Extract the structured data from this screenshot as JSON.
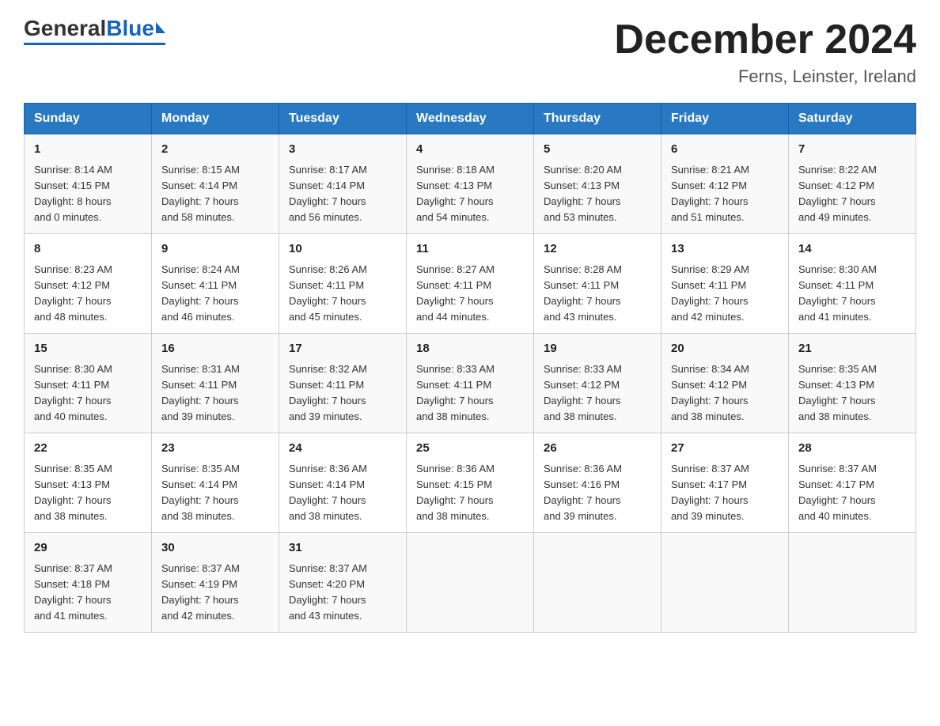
{
  "header": {
    "logo": {
      "general": "General",
      "blue": "Blue"
    },
    "title": "December 2024",
    "location": "Ferns, Leinster, Ireland"
  },
  "columns": [
    "Sunday",
    "Monday",
    "Tuesday",
    "Wednesday",
    "Thursday",
    "Friday",
    "Saturday"
  ],
  "weeks": [
    [
      {
        "day": "1",
        "sunrise": "Sunrise: 8:14 AM",
        "sunset": "Sunset: 4:15 PM",
        "daylight": "Daylight: 8 hours",
        "daylight2": "and 0 minutes."
      },
      {
        "day": "2",
        "sunrise": "Sunrise: 8:15 AM",
        "sunset": "Sunset: 4:14 PM",
        "daylight": "Daylight: 7 hours",
        "daylight2": "and 58 minutes."
      },
      {
        "day": "3",
        "sunrise": "Sunrise: 8:17 AM",
        "sunset": "Sunset: 4:14 PM",
        "daylight": "Daylight: 7 hours",
        "daylight2": "and 56 minutes."
      },
      {
        "day": "4",
        "sunrise": "Sunrise: 8:18 AM",
        "sunset": "Sunset: 4:13 PM",
        "daylight": "Daylight: 7 hours",
        "daylight2": "and 54 minutes."
      },
      {
        "day": "5",
        "sunrise": "Sunrise: 8:20 AM",
        "sunset": "Sunset: 4:13 PM",
        "daylight": "Daylight: 7 hours",
        "daylight2": "and 53 minutes."
      },
      {
        "day": "6",
        "sunrise": "Sunrise: 8:21 AM",
        "sunset": "Sunset: 4:12 PM",
        "daylight": "Daylight: 7 hours",
        "daylight2": "and 51 minutes."
      },
      {
        "day": "7",
        "sunrise": "Sunrise: 8:22 AM",
        "sunset": "Sunset: 4:12 PM",
        "daylight": "Daylight: 7 hours",
        "daylight2": "and 49 minutes."
      }
    ],
    [
      {
        "day": "8",
        "sunrise": "Sunrise: 8:23 AM",
        "sunset": "Sunset: 4:12 PM",
        "daylight": "Daylight: 7 hours",
        "daylight2": "and 48 minutes."
      },
      {
        "day": "9",
        "sunrise": "Sunrise: 8:24 AM",
        "sunset": "Sunset: 4:11 PM",
        "daylight": "Daylight: 7 hours",
        "daylight2": "and 46 minutes."
      },
      {
        "day": "10",
        "sunrise": "Sunrise: 8:26 AM",
        "sunset": "Sunset: 4:11 PM",
        "daylight": "Daylight: 7 hours",
        "daylight2": "and 45 minutes."
      },
      {
        "day": "11",
        "sunrise": "Sunrise: 8:27 AM",
        "sunset": "Sunset: 4:11 PM",
        "daylight": "Daylight: 7 hours",
        "daylight2": "and 44 minutes."
      },
      {
        "day": "12",
        "sunrise": "Sunrise: 8:28 AM",
        "sunset": "Sunset: 4:11 PM",
        "daylight": "Daylight: 7 hours",
        "daylight2": "and 43 minutes."
      },
      {
        "day": "13",
        "sunrise": "Sunrise: 8:29 AM",
        "sunset": "Sunset: 4:11 PM",
        "daylight": "Daylight: 7 hours",
        "daylight2": "and 42 minutes."
      },
      {
        "day": "14",
        "sunrise": "Sunrise: 8:30 AM",
        "sunset": "Sunset: 4:11 PM",
        "daylight": "Daylight: 7 hours",
        "daylight2": "and 41 minutes."
      }
    ],
    [
      {
        "day": "15",
        "sunrise": "Sunrise: 8:30 AM",
        "sunset": "Sunset: 4:11 PM",
        "daylight": "Daylight: 7 hours",
        "daylight2": "and 40 minutes."
      },
      {
        "day": "16",
        "sunrise": "Sunrise: 8:31 AM",
        "sunset": "Sunset: 4:11 PM",
        "daylight": "Daylight: 7 hours",
        "daylight2": "and 39 minutes."
      },
      {
        "day": "17",
        "sunrise": "Sunrise: 8:32 AM",
        "sunset": "Sunset: 4:11 PM",
        "daylight": "Daylight: 7 hours",
        "daylight2": "and 39 minutes."
      },
      {
        "day": "18",
        "sunrise": "Sunrise: 8:33 AM",
        "sunset": "Sunset: 4:11 PM",
        "daylight": "Daylight: 7 hours",
        "daylight2": "and 38 minutes."
      },
      {
        "day": "19",
        "sunrise": "Sunrise: 8:33 AM",
        "sunset": "Sunset: 4:12 PM",
        "daylight": "Daylight: 7 hours",
        "daylight2": "and 38 minutes."
      },
      {
        "day": "20",
        "sunrise": "Sunrise: 8:34 AM",
        "sunset": "Sunset: 4:12 PM",
        "daylight": "Daylight: 7 hours",
        "daylight2": "and 38 minutes."
      },
      {
        "day": "21",
        "sunrise": "Sunrise: 8:35 AM",
        "sunset": "Sunset: 4:13 PM",
        "daylight": "Daylight: 7 hours",
        "daylight2": "and 38 minutes."
      }
    ],
    [
      {
        "day": "22",
        "sunrise": "Sunrise: 8:35 AM",
        "sunset": "Sunset: 4:13 PM",
        "daylight": "Daylight: 7 hours",
        "daylight2": "and 38 minutes."
      },
      {
        "day": "23",
        "sunrise": "Sunrise: 8:35 AM",
        "sunset": "Sunset: 4:14 PM",
        "daylight": "Daylight: 7 hours",
        "daylight2": "and 38 minutes."
      },
      {
        "day": "24",
        "sunrise": "Sunrise: 8:36 AM",
        "sunset": "Sunset: 4:14 PM",
        "daylight": "Daylight: 7 hours",
        "daylight2": "and 38 minutes."
      },
      {
        "day": "25",
        "sunrise": "Sunrise: 8:36 AM",
        "sunset": "Sunset: 4:15 PM",
        "daylight": "Daylight: 7 hours",
        "daylight2": "and 38 minutes."
      },
      {
        "day": "26",
        "sunrise": "Sunrise: 8:36 AM",
        "sunset": "Sunset: 4:16 PM",
        "daylight": "Daylight: 7 hours",
        "daylight2": "and 39 minutes."
      },
      {
        "day": "27",
        "sunrise": "Sunrise: 8:37 AM",
        "sunset": "Sunset: 4:17 PM",
        "daylight": "Daylight: 7 hours",
        "daylight2": "and 39 minutes."
      },
      {
        "day": "28",
        "sunrise": "Sunrise: 8:37 AM",
        "sunset": "Sunset: 4:17 PM",
        "daylight": "Daylight: 7 hours",
        "daylight2": "and 40 minutes."
      }
    ],
    [
      {
        "day": "29",
        "sunrise": "Sunrise: 8:37 AM",
        "sunset": "Sunset: 4:18 PM",
        "daylight": "Daylight: 7 hours",
        "daylight2": "and 41 minutes."
      },
      {
        "day": "30",
        "sunrise": "Sunrise: 8:37 AM",
        "sunset": "Sunset: 4:19 PM",
        "daylight": "Daylight: 7 hours",
        "daylight2": "and 42 minutes."
      },
      {
        "day": "31",
        "sunrise": "Sunrise: 8:37 AM",
        "sunset": "Sunset: 4:20 PM",
        "daylight": "Daylight: 7 hours",
        "daylight2": "and 43 minutes."
      },
      null,
      null,
      null,
      null
    ]
  ]
}
